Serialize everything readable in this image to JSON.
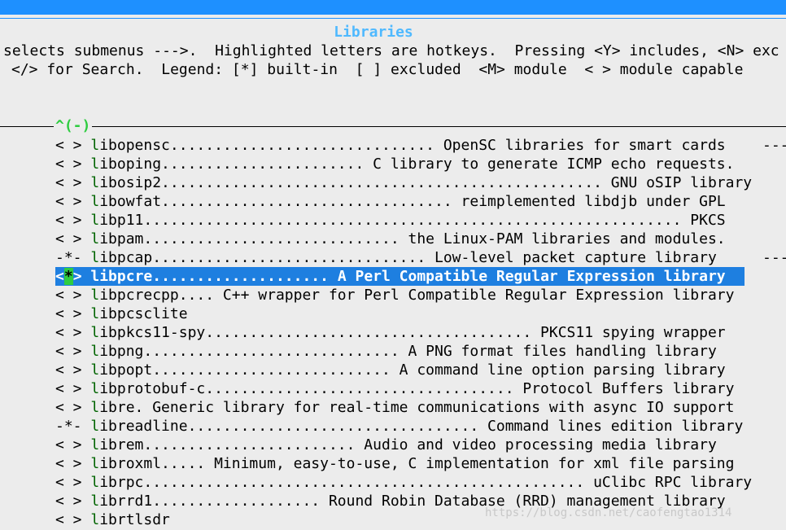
{
  "title": "Libraries",
  "help_line_1": "selects submenus --->.  Highlighted letters are hotkeys.  Pressing <Y> includes, <N> exc",
  "help_line_2": "</> for Search.  Legend: [*] built-in  [ ] excluded  <M> module  < > module capable",
  "scroll_indicator": "^(-)",
  "items": [
    {
      "mark": "< >",
      "hot": "l",
      "rest": "ibopensc.............................. OpenSC libraries for smart cards"
    },
    {
      "mark": "< >",
      "hot": "l",
      "rest": "iboping....................... C library to generate ICMP echo requests."
    },
    {
      "mark": "< >",
      "hot": "l",
      "rest": "ibosip2.................................................. GNU oSIP library"
    },
    {
      "mark": "< >",
      "hot": "l",
      "rest": "ibowfat................................. reimplemented libdjb under GPL"
    },
    {
      "mark": "< >",
      "hot": "l",
      "rest": "ibp11............................................................. PKCS"
    },
    {
      "mark": "< >",
      "hot": "l",
      "rest": "ibpam............................. the Linux-PAM libraries and modules."
    },
    {
      "mark": "-*-",
      "hot": "l",
      "rest": "ibpcap............................... Low-level packet capture library"
    },
    {
      "mark": "<*>",
      "hot": "l",
      "rest": "ibpcre.................... A Perl Compatible Regular Expression library",
      "selected": true
    },
    {
      "mark": "< >",
      "hot": "l",
      "rest": "ibpcrecpp.... C++ wrapper for Perl Compatible Regular Expression library"
    },
    {
      "mark": "< >",
      "hot": "l",
      "rest": "ibpcsclite"
    },
    {
      "mark": "< >",
      "hot": "l",
      "rest": "ibpkcs11-spy..................................... PKCS11 spying wrapper"
    },
    {
      "mark": "< >",
      "hot": "l",
      "rest": "ibpng............................. A PNG format files handling library"
    },
    {
      "mark": "< >",
      "hot": "l",
      "rest": "ibpopt........................... A command line option parsing library"
    },
    {
      "mark": "< >",
      "hot": "l",
      "rest": "ibprotobuf-c................................... Protocol Buffers library"
    },
    {
      "mark": "< >",
      "hot": "l",
      "rest": "ibre. Generic library for real-time communications with async IO support"
    },
    {
      "mark": "-*-",
      "hot": "l",
      "rest": "ibreadline................................. Command lines edition library"
    },
    {
      "mark": "< >",
      "hot": "l",
      "rest": "ibrem........................ Audio and video processing media library"
    },
    {
      "mark": "< >",
      "hot": "l",
      "rest": "ibroxml..... Minimum, easy-to-use, C implementation for xml file parsing"
    },
    {
      "mark": "< >",
      "hot": "l",
      "rest": "ibrpc.................................................. uClibc RPC library"
    },
    {
      "mark": "< >",
      "hot": "l",
      "rest": "ibrrd1................... Round Robin Database (RRD) management library"
    },
    {
      "mark": "< >",
      "hot": "l",
      "rest": "ibrtlsdr"
    }
  ],
  "submenu_arrows": [
    "---",
    "---"
  ],
  "watermark": "https://blog.csdn.net/caofengtao1314"
}
